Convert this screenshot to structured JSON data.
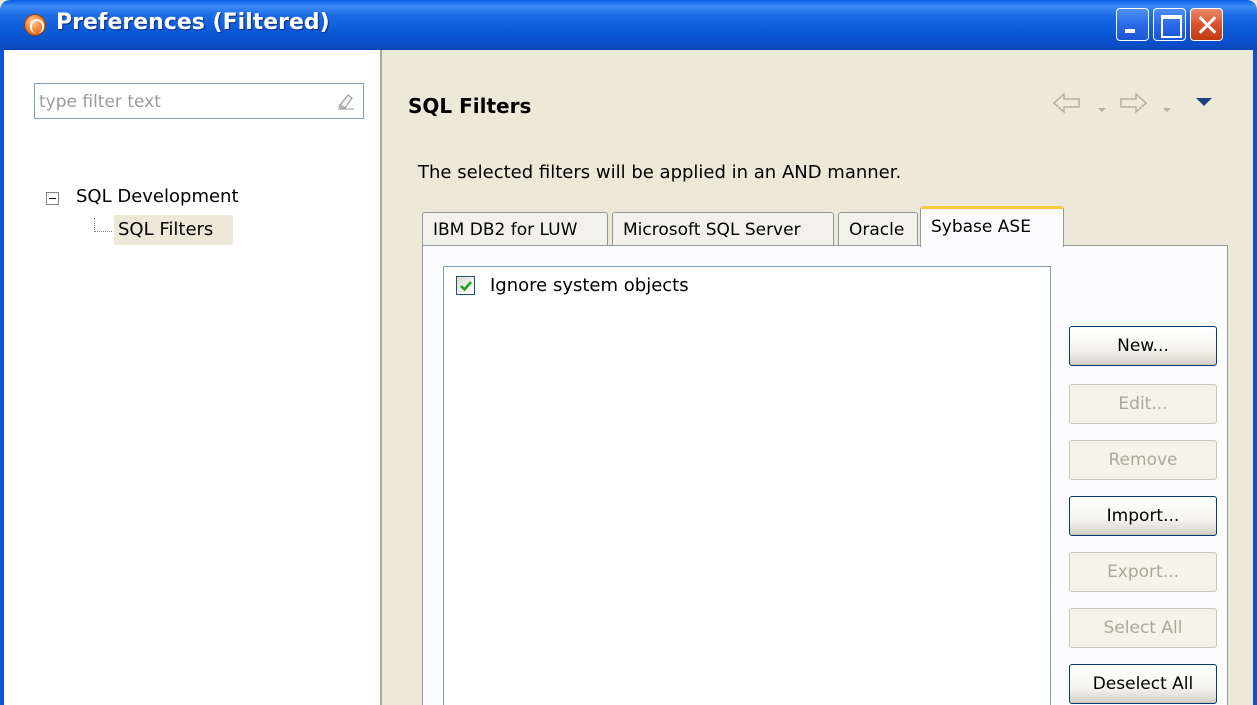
{
  "window": {
    "title": "Preferences (Filtered)",
    "controls": [
      "minimize",
      "maximize",
      "close"
    ]
  },
  "left": {
    "filter_placeholder": "type filter text",
    "tree": {
      "root": "SQL Development",
      "child": "SQL Filters"
    }
  },
  "right": {
    "title": "SQL Filters",
    "description": "The selected filters will be applied in an AND manner.",
    "tabs": [
      {
        "label": "IBM DB2 for LUW",
        "active": false
      },
      {
        "label": "Microsoft SQL Server",
        "active": false
      },
      {
        "label": "Oracle",
        "active": false
      },
      {
        "label": "Sybase ASE",
        "active": true
      }
    ],
    "filters": [
      {
        "label": "Ignore system objects",
        "checked": true
      }
    ],
    "buttons": [
      {
        "label": "New...",
        "enabled": true
      },
      {
        "label": "Edit...",
        "enabled": false
      },
      {
        "label": "Remove",
        "enabled": false
      },
      {
        "label": "Import...",
        "enabled": true
      },
      {
        "label": "Export...",
        "enabled": false
      },
      {
        "label": "Select All",
        "enabled": false
      },
      {
        "label": "Deselect All",
        "enabled": true
      }
    ]
  },
  "colors": {
    "titlebar": "#0b5ad8",
    "window_bg": "#ece9d8",
    "active_tab_accent": "#ffc73c",
    "checkmark": "#21a121"
  }
}
